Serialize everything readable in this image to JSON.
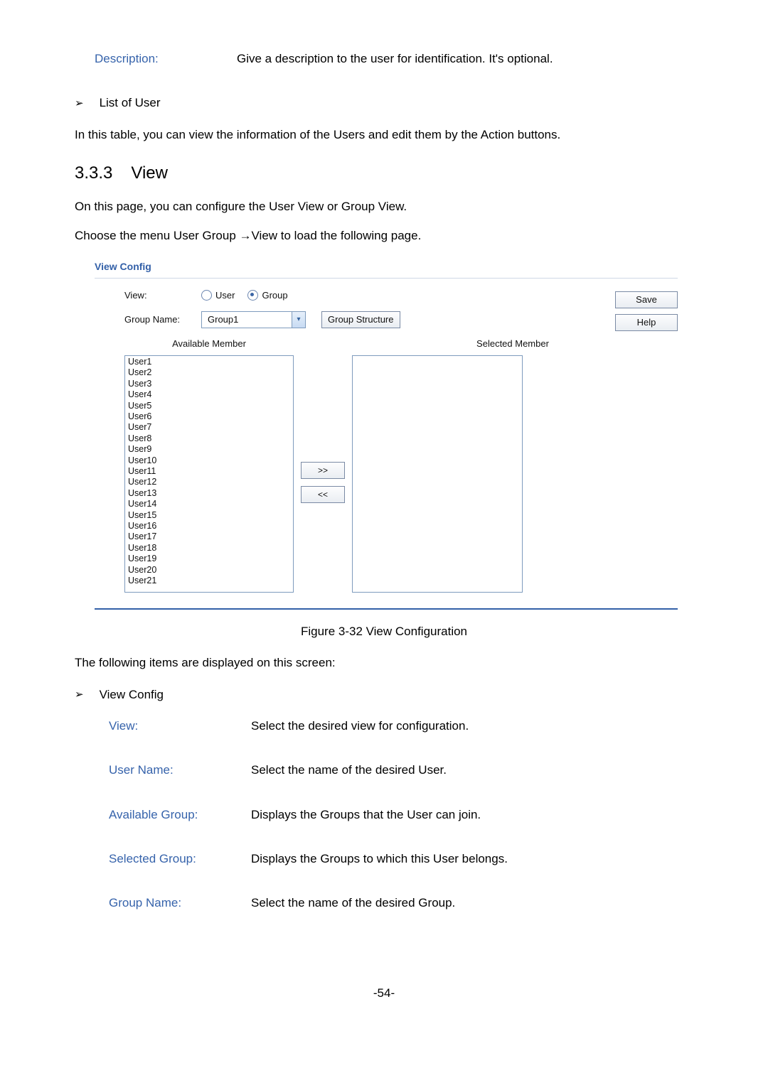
{
  "top_def": {
    "term": "Description:",
    "text": "Give a description to the user for identification. It's optional."
  },
  "list_of_user": {
    "heading": "List of User",
    "text": "In this table, you can view the information of the Users and edit them by the Action buttons."
  },
  "section": {
    "number": "3.3.3",
    "title": "View"
  },
  "intro1": "On this page, you can configure the User View or Group View.",
  "intro2": "Choose the menu User Group →View to load the following page.",
  "figure": {
    "panel_title": "View Config",
    "view_label": "View:",
    "radio_user": "User",
    "radio_group": "Group",
    "group_name_label": "Group Name:",
    "group_name_value": "Group1",
    "group_structure_btn": "Group Structure",
    "available_label": "Available Member",
    "selected_label": "Selected Member",
    "members": [
      "User1",
      "User2",
      "User3",
      "User4",
      "User5",
      "User6",
      "User7",
      "User8",
      "User9",
      "User10",
      "User11",
      "User12",
      "User13",
      "User14",
      "User15",
      "User16",
      "User17",
      "User18",
      "User19",
      "User20",
      "User21"
    ],
    "btn_add": ">>",
    "btn_remove": "<<",
    "btn_save": "Save",
    "btn_help": "Help"
  },
  "caption": "Figure 3-32 View Configuration",
  "after_fig": "The following items are displayed on this screen:",
  "view_config_heading": "View Config",
  "defs": [
    {
      "term": "View:",
      "text": "Select the desired view for configuration."
    },
    {
      "term": "User Name:",
      "text": "Select the name of the desired User."
    },
    {
      "term": "Available Group:",
      "text": "Displays the Groups that the User can join."
    },
    {
      "term": "Selected Group:",
      "text": "Displays the Groups to which this User belongs."
    },
    {
      "term": "Group Name:",
      "text": "Select the name of the desired Group."
    }
  ],
  "page_number": "-54-"
}
